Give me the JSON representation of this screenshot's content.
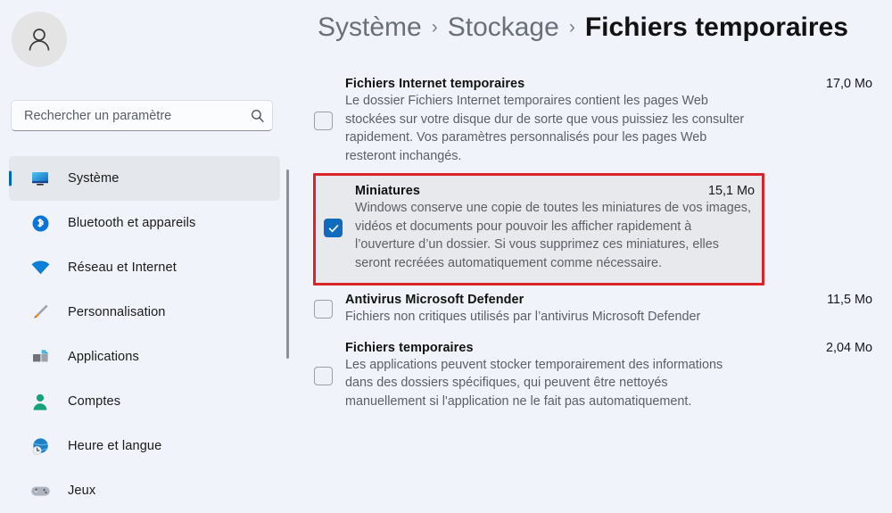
{
  "sidebar": {
    "avatar": {
      "icon": "user-avatar-icon"
    },
    "search": {
      "placeholder": "Rechercher un paramètre",
      "value": "",
      "icon": "search-icon"
    },
    "items": [
      {
        "label": "Système",
        "icon": "monitor-icon",
        "active": true
      },
      {
        "label": "Bluetooth et appareils",
        "icon": "bluetooth-icon",
        "active": false
      },
      {
        "label": "Réseau et Internet",
        "icon": "wifi-icon",
        "active": false
      },
      {
        "label": "Personnalisation",
        "icon": "paintbrush-icon",
        "active": false
      },
      {
        "label": "Applications",
        "icon": "apps-icon",
        "active": false
      },
      {
        "label": "Comptes",
        "icon": "account-person-icon",
        "active": false
      },
      {
        "label": "Heure et langue",
        "icon": "clock-globe-icon",
        "active": false
      },
      {
        "label": "Jeux",
        "icon": "gamepad-icon",
        "active": false
      }
    ]
  },
  "header": {
    "breadcrumb": [
      {
        "label": "Système",
        "current": false
      },
      {
        "label": "Stockage",
        "current": false
      },
      {
        "label": "Fichiers temporaires",
        "current": true
      }
    ],
    "separator": "›"
  },
  "main": {
    "items": [
      {
        "title": "Fichiers Internet temporaires",
        "size": "17,0 Mo",
        "description": "Le dossier Fichiers Internet temporaires contient les pages Web stockées sur votre disque dur de sorte que vous puissiez les consulter rapidement. Vos paramètres personnalisés pour les pages Web resteront inchangés.",
        "checked": false,
        "highlighted": false
      },
      {
        "title": "Miniatures",
        "size": "15,1 Mo",
        "description": "Windows conserve une copie de toutes les miniatures de vos images, vidéos et documents pour pouvoir les afficher rapidement à l’ouverture d’un dossier. Si vous supprimez ces miniatures, elles seront recréées automatiquement comme nécessaire.",
        "checked": true,
        "highlighted": true
      },
      {
        "title": "Antivirus Microsoft Defender",
        "size": "11,5 Mo",
        "description": "Fichiers non critiques utilisés par l’antivirus Microsoft Defender",
        "checked": false,
        "highlighted": false
      },
      {
        "title": "Fichiers temporaires",
        "size": "2,04 Mo",
        "description": "Les applications peuvent stocker temporairement des informations dans des dossiers spécifiques, qui peuvent être nettoyés manuellement si l'application ne le fait pas automatiquement.",
        "checked": false,
        "highlighted": false
      }
    ]
  },
  "colors": {
    "page_background": "#f0f3fa",
    "accent": "#0067c0",
    "highlight_border": "#d9252a",
    "checkbox_checked": "#0f6cbd"
  }
}
